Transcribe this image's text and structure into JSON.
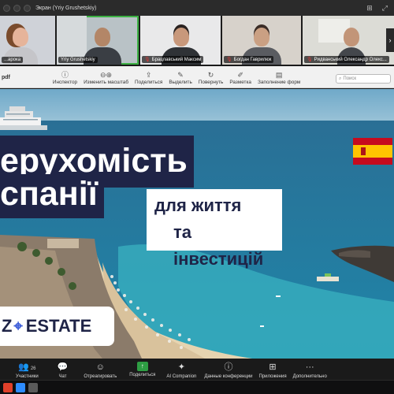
{
  "window": {
    "title": "Экран (Yriy Grushetskiy)"
  },
  "participants": [
    {
      "name": "...арока",
      "mic_off": false
    },
    {
      "name": "Yriy Grushetskiy",
      "mic_off": false,
      "active": true
    },
    {
      "name": "Брацлавський Максим",
      "mic_off": true
    },
    {
      "name": "Богдан Гаврилюк",
      "mic_off": true
    },
    {
      "name": "Ридванський Олександр Олекс...",
      "mic_off": true
    }
  ],
  "pdf_toolbar": {
    "file_label": "pdf",
    "items": [
      {
        "label": "Инспектор",
        "icon": "info-icon"
      },
      {
        "label": "Изменить масштаб",
        "icon": "zoom-icon"
      },
      {
        "label": "Поделиться",
        "icon": "share-icon"
      },
      {
        "label": "Выделить",
        "icon": "highlight-icon"
      },
      {
        "label": "Повернуть",
        "icon": "rotate-icon"
      },
      {
        "label": "Разметка",
        "icon": "markup-icon"
      },
      {
        "label": "Заполнение форм",
        "icon": "form-icon"
      }
    ],
    "search_label": "Поиск"
  },
  "slide": {
    "headline_line1": "ерухомість",
    "headline_line2": "спанії",
    "subtitle_line1": "для життя",
    "subtitle_line2": "та інвестицій",
    "logo_left": "Z",
    "logo_right": "ESTATE",
    "flag_colors": {
      "red": "#c60b1e",
      "yellow": "#ffc400"
    }
  },
  "controls": [
    {
      "label": "Участники",
      "icon": "participants-icon",
      "badge": "26"
    },
    {
      "label": "Чат",
      "icon": "chat-icon"
    },
    {
      "label": "Отреагировать",
      "icon": "react-icon"
    },
    {
      "label": "Поделиться",
      "icon": "share-screen-icon"
    },
    {
      "label": "AI Companion",
      "icon": "ai-companion-icon"
    },
    {
      "label": "Данные конференции",
      "icon": "info-icon"
    },
    {
      "label": "Приложения",
      "icon": "apps-icon"
    },
    {
      "label": "Дополнительно",
      "icon": "more-icon"
    }
  ]
}
